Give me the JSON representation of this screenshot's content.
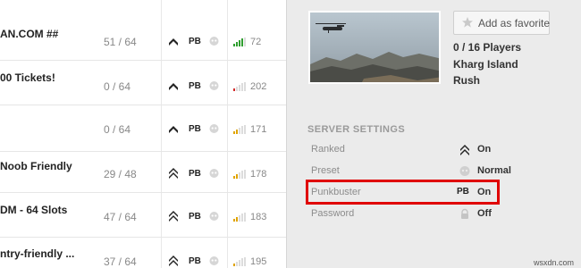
{
  "servers": [
    {
      "name": "AN.COM ##",
      "players": "51 / 64",
      "ping": "72",
      "ping_color": "#2f9e2f"
    },
    {
      "name": "00 Tickets!",
      "players": "0 / 64",
      "ping": "202",
      "ping_color": "#d32a2a"
    },
    {
      "name": "",
      "players": "0 / 64",
      "ping": "171",
      "ping_color": "#e0a400"
    },
    {
      "name": "Noob Friendly",
      "players": "29 / 48",
      "ping": "178",
      "ping_color": "#e0a400"
    },
    {
      "name": "DM - 64 Slots",
      "players": "47 / 64",
      "ping": "183",
      "ping_color": "#e0a400"
    },
    {
      "name": "ntry-friendly ...",
      "players": "37 / 64",
      "ping": "195",
      "ping_color": "#e0a400"
    }
  ],
  "pb_badge": "PB",
  "panel": {
    "favorite_label": "Add as favorite",
    "players": "0 / 16 Players",
    "map": "Kharg Island",
    "mode": "Rush"
  },
  "settings": {
    "title": "SERVER SETTINGS",
    "rows": [
      {
        "label": "Ranked",
        "value": "On",
        "icon": "rank-chevron-icon"
      },
      {
        "label": "Preset",
        "value": "Normal",
        "icon": "skull-icon"
      },
      {
        "label": "Punkbuster",
        "value": "On",
        "icon": "punkbuster-icon"
      },
      {
        "label": "Password",
        "value": "Off",
        "icon": "lock-icon"
      }
    ]
  },
  "watermark": "wsxdn.com",
  "colors": {
    "highlight": "#e00000",
    "panel_bg": "#ebebeb"
  }
}
